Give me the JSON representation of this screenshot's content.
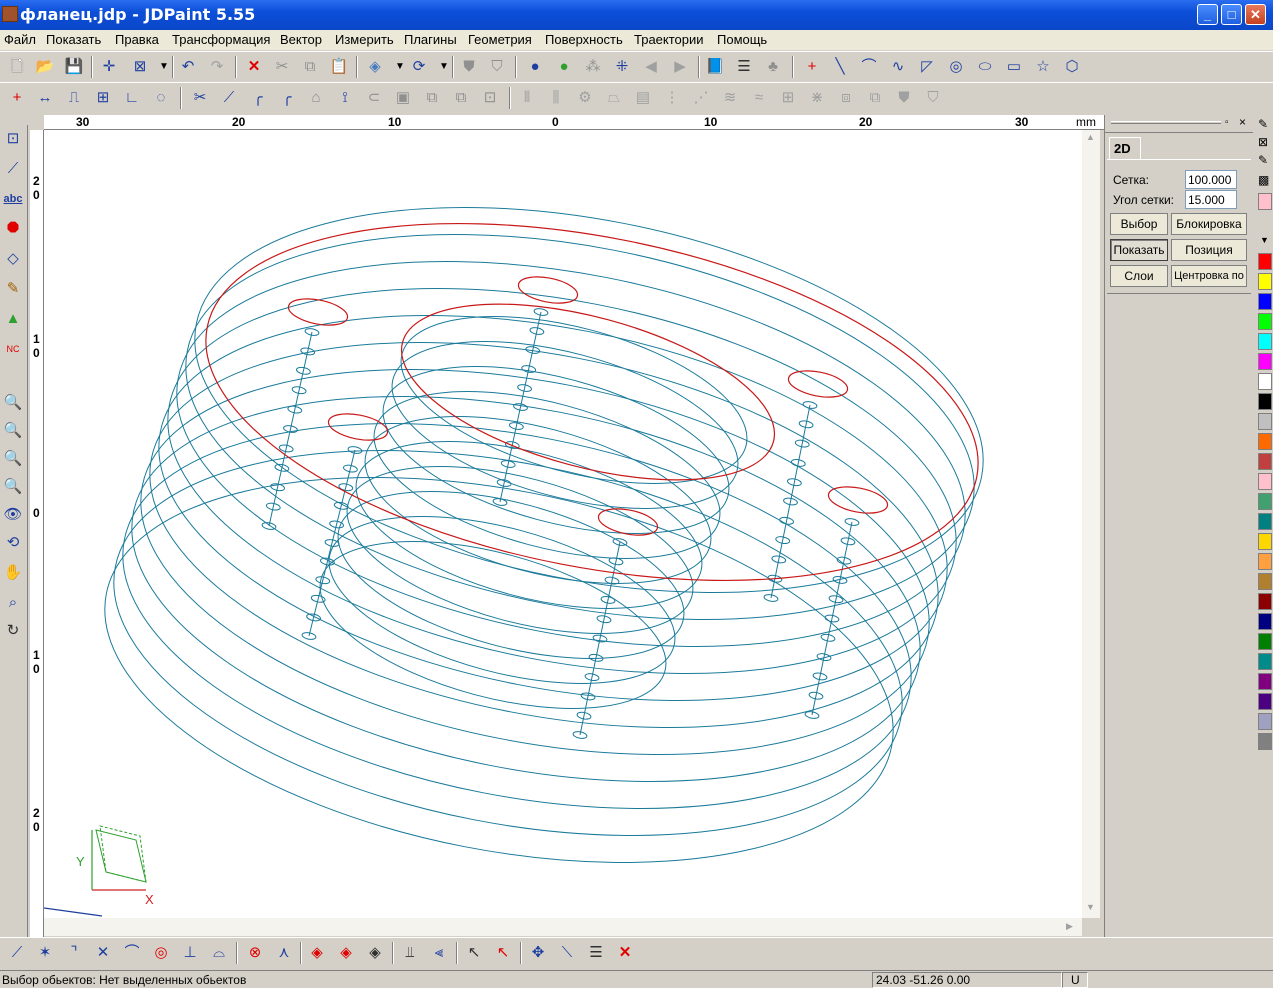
{
  "window": {
    "title": "фланец.jdp - JDPaint 5.55"
  },
  "menu": [
    "Файл",
    "Показать",
    "Правка",
    "Трансформация",
    "Вектор",
    "Измерить",
    "Плагины",
    "Геометрия",
    "Поверхность",
    "Траектории",
    "Помощь"
  ],
  "ruler": {
    "top_labels": [
      "30",
      "20",
      "10",
      "0",
      "10",
      "20",
      "30"
    ],
    "unit": "mm",
    "left_labels": [
      "2\n0",
      "1\n0",
      "0",
      "1\n0",
      "2\n0"
    ]
  },
  "panel": {
    "tab": "2D",
    "grid_label": "Сетка:",
    "grid_value": "100.000",
    "angle_label": "Угол сетки:",
    "angle_value": "15.000",
    "buttons": {
      "select": "Выбор",
      "lock": "Блокировка",
      "show": "Показать",
      "position": "Позиция",
      "layers": "Слои",
      "center": "Центровка по"
    }
  },
  "palette": [
    "#ff0000",
    "#ffff00",
    "#0000ff",
    "#00ff00",
    "#00ffff",
    "#ff00ff",
    "#ffffff",
    "#000000",
    "#c0c0c0",
    "#ff6a00",
    "#c04040",
    "#ffc0cb",
    "#40a070",
    "#008080",
    "#ffd700",
    "#ffa040",
    "#b08030",
    "#8b0000",
    "#000080",
    "#008000",
    "#008b8b",
    "#800080",
    "#4b0082",
    "#a0a0c0",
    "#808080"
  ],
  "colors": {
    "wire_blue": "#1a7a9a",
    "wire_red": "#c81818"
  },
  "axes": {
    "x": "X",
    "y": "Y"
  },
  "status": {
    "message": "Выбор обьектов: Нет выделенных обьектов",
    "coords": "24.03 -51.26 0.00",
    "unit_flag": "U"
  }
}
